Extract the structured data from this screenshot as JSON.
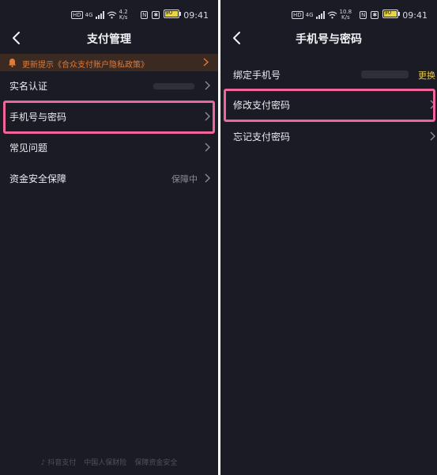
{
  "left": {
    "status": {
      "speed_value": "4.2",
      "speed_unit": "K/s",
      "time": "09:41",
      "battery": "90",
      "net": "4G",
      "hd": "HD"
    },
    "nav": {
      "title": "支付管理"
    },
    "notice": {
      "text": "更新提示《合众支付账户隐私政策》"
    },
    "rows": [
      {
        "label": "实名认证",
        "value": ""
      },
      {
        "label": "手机号与密码",
        "value": ""
      },
      {
        "label": "常见问题",
        "value": ""
      },
      {
        "label": "资金安全保障",
        "value": "保障中"
      }
    ],
    "footer": {
      "a": "抖音支付",
      "b": "中国人保财险",
      "c": "保障资金安全"
    }
  },
  "right": {
    "status": {
      "speed_value": "10.8",
      "speed_unit": "K/s",
      "time": "09:41",
      "battery": "90",
      "net": "4G",
      "hd": "HD"
    },
    "nav": {
      "title": "手机号与密码"
    },
    "rows": [
      {
        "label": "绑定手机号",
        "action": "更换"
      },
      {
        "label": "修改支付密码"
      },
      {
        "label": "忘记支付密码"
      }
    ]
  },
  "colors": {
    "background": "#1a1b25",
    "highlight": "#f0669a",
    "notice_text": "#e07a3a",
    "action": "#e6c84a"
  }
}
